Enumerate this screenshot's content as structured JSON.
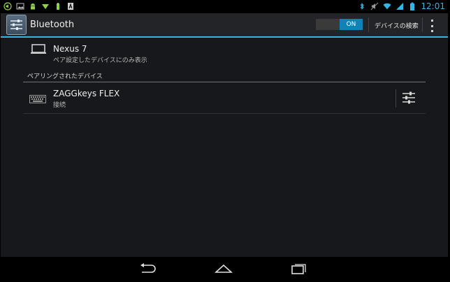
{
  "status_bar": {
    "left_icons": [
      "volume-icon",
      "image-icon",
      "android-icon",
      "download-icon",
      "battery-small-icon",
      "text-icon"
    ],
    "right_icons": [
      "bluetooth-icon",
      "mute-icon",
      "wifi-icon",
      "signal-icon",
      "battery-icon"
    ],
    "time": "12:01"
  },
  "action_bar": {
    "title": "Bluetooth",
    "toggle_label": "ON",
    "search_label": "デバイスの検索"
  },
  "this_device": {
    "name": "Nexus 7",
    "subtitle": "ペア設定したデバイスにのみ表示"
  },
  "paired": {
    "header": "ペアリングされたデバイス",
    "devices": [
      {
        "name": "ZAGGkeys FLEX",
        "status": "接続"
      }
    ]
  },
  "nav_bar": {
    "buttons": [
      "back-icon",
      "home-icon",
      "recents-icon"
    ]
  },
  "colors": {
    "accent": "#33b5e5",
    "toggle_on": "#0e83b8",
    "background": "#16181b"
  }
}
